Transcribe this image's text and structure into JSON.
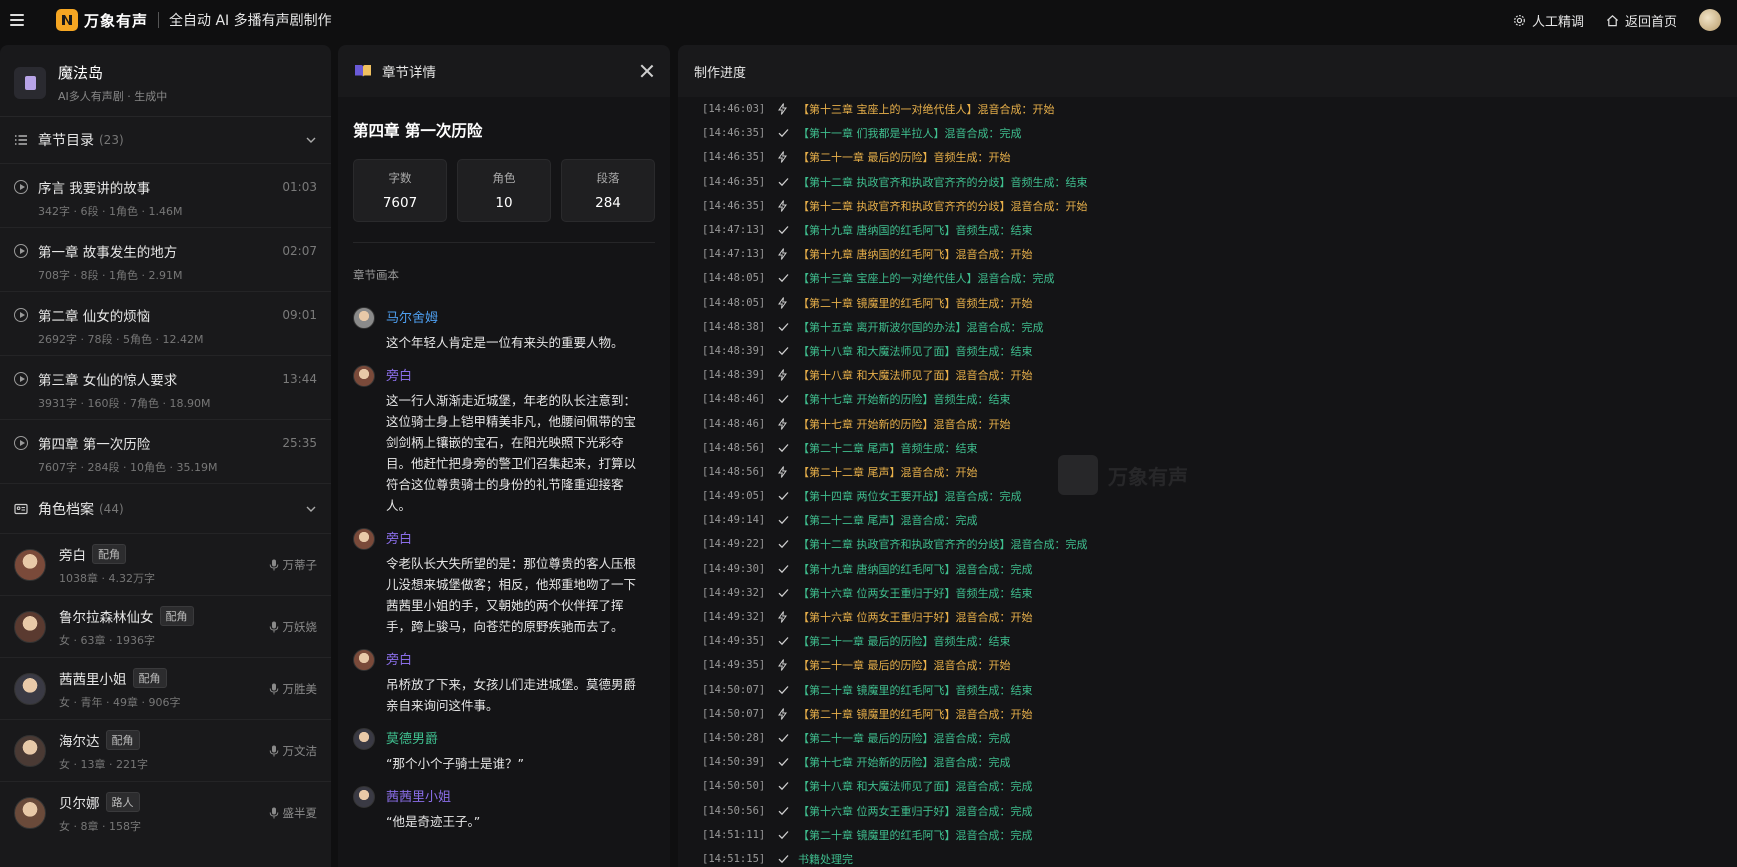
{
  "header": {
    "brand": "万象有声",
    "subtitle": "全自动 AI 多播有声剧制作",
    "manual_tune": "人工精调",
    "back_home": "返回首页"
  },
  "book": {
    "title": "魔法岛",
    "meta": "AI多人有声剧 · 生成中"
  },
  "chapters_section": {
    "title": "章节目录",
    "count": "(23)"
  },
  "chapters": [
    {
      "title": "序言 我要讲的故事",
      "meta": "342字 · 6段 · 1角色 · 1.46M",
      "time": "01:03"
    },
    {
      "title": "第一章 故事发生的地方",
      "meta": "708字 · 8段 · 1角色 · 2.91M",
      "time": "02:07"
    },
    {
      "title": "第二章 仙女的烦恼",
      "meta": "2692字 · 78段 · 5角色 · 12.42M",
      "time": "09:01"
    },
    {
      "title": "第三章 女仙的惊人要求",
      "meta": "3931字 · 160段 · 7角色 · 18.90M",
      "time": "13:44"
    },
    {
      "title": "第四章 第一次历险",
      "meta": "7607字 · 284段 · 10角色 · 35.19M",
      "time": "25:35"
    }
  ],
  "roles_section": {
    "title": "角色档案",
    "count": "(44)"
  },
  "roles": [
    {
      "name": "旁白",
      "tag": "配角",
      "meta": "1038章 · 4.32万字",
      "voice": "万蒂子",
      "color": "#7a4a3a"
    },
    {
      "name": "鲁尔拉森林仙女",
      "tag": "配角",
      "meta": "女 · 63章 · 1936字",
      "voice": "万妖娆",
      "color": "#5a3a30"
    },
    {
      "name": "茜茜里小姐",
      "tag": "配角",
      "meta": "女 · 青年 · 49章 · 906字",
      "voice": "万胜美",
      "color": "#3a3a44"
    },
    {
      "name": "海尔达",
      "tag": "配角",
      "meta": "女 · 13章 · 221字",
      "voice": "万文洁",
      "color": "#4a3a34"
    },
    {
      "name": "贝尔娜",
      "tag": "路人",
      "meta": "女 · 8章 · 158字",
      "voice": "盛半夏",
      "color": "#6a4a3a"
    }
  ],
  "detail": {
    "title": "章节详情",
    "chapter_name": "第四章 第一次历险",
    "stats": [
      {
        "label": "字数",
        "value": "7607"
      },
      {
        "label": "角色",
        "value": "10"
      },
      {
        "label": "段落",
        "value": "284"
      }
    ],
    "script_label": "章节画本",
    "lines": [
      {
        "speaker": "马尔舍姆",
        "color": "#4e9ff0",
        "text": "这个年轻人肯定是一位有来头的重要人物。",
        "avatar": "#8a8a8a"
      },
      {
        "speaker": "旁白",
        "color": "#8a6ee8",
        "text": "这一行人渐渐走近城堡，年老的队长注意到：这位骑士身上铠甲精美非凡，他腰间佩带的宝剑剑柄上镶嵌的宝石，在阳光映照下光彩夺目。他赶忙把身旁的警卫们召集起来，打算以符合这位尊贵骑士的身份的礼节隆重迎接客人。",
        "avatar": "#7a4a3a"
      },
      {
        "speaker": "旁白",
        "color": "#8a6ee8",
        "text": "令老队长大失所望的是：那位尊贵的客人压根儿没想来城堡做客；相反，他郑重地吻了一下茜茜里小姐的手，又朝她的两个伙伴挥了挥手，跨上骏马，向苍茫的原野疾驰而去了。",
        "avatar": "#7a4a3a"
      },
      {
        "speaker": "旁白",
        "color": "#8a6ee8",
        "text": "吊桥放了下来，女孩儿们走进城堡。莫德男爵亲自来询问这件事。",
        "avatar": "#7a4a3a"
      },
      {
        "speaker": "莫德男爵",
        "color": "#3fbf8f",
        "text": "“那个小个子骑士是谁？”",
        "avatar": "#3a3a44"
      },
      {
        "speaker": "茜茜里小姐",
        "color": "#8a6ee8",
        "text": "“他是奇迹王子。”",
        "avatar": "#3a3a44"
      }
    ]
  },
  "progress": {
    "title": "制作进度",
    "watermark": "万象有声",
    "logs": [
      {
        "time": "[14:46:03]",
        "status": "start",
        "text": "【第十三章 宝座上的一对绝代佳人】混音合成：开始"
      },
      {
        "time": "[14:46:35]",
        "status": "done",
        "text": "【第十一章 们我都是半拉人】混音合成：完成"
      },
      {
        "time": "[14:46:35]",
        "status": "start",
        "text": "【第二十一章 最后的历险】音频生成：开始"
      },
      {
        "time": "[14:46:35]",
        "status": "done",
        "text": "【第十二章 执政官齐和执政官齐齐的分歧】音频生成：结束"
      },
      {
        "time": "[14:46:35]",
        "status": "start",
        "text": "【第十二章 执政官齐和执政官齐齐的分歧】混音合成：开始"
      },
      {
        "time": "[14:47:13]",
        "status": "done",
        "text": "【第十九章 唐纳国的红毛阿飞】音频生成：结束"
      },
      {
        "time": "[14:47:13]",
        "status": "start",
        "text": "【第十九章 唐纳国的红毛阿飞】混音合成：开始"
      },
      {
        "time": "[14:48:05]",
        "status": "done",
        "text": "【第十三章 宝座上的一对绝代佳人】混音合成：完成"
      },
      {
        "time": "[14:48:05]",
        "status": "start",
        "text": "【第二十章 镜魔里的红毛阿飞】音频生成：开始"
      },
      {
        "time": "[14:48:38]",
        "status": "done",
        "text": "【第十五章 离开斯波尔国的办法】混音合成：完成"
      },
      {
        "time": "[14:48:39]",
        "status": "done",
        "text": "【第十八章 和大魔法师见了面】音频生成：结束"
      },
      {
        "time": "[14:48:39]",
        "status": "start",
        "text": "【第十八章 和大魔法师见了面】混音合成：开始"
      },
      {
        "time": "[14:48:46]",
        "status": "done",
        "text": "【第十七章 开始新的历险】音频生成：结束"
      },
      {
        "time": "[14:48:46]",
        "status": "start",
        "text": "【第十七章 开始新的历险】混音合成：开始"
      },
      {
        "time": "[14:48:56]",
        "status": "done",
        "text": "【第二十二章 尾声】音频生成：结束"
      },
      {
        "time": "[14:48:56]",
        "status": "start",
        "text": "【第二十二章 尾声】混音合成：开始"
      },
      {
        "time": "[14:49:05]",
        "status": "done",
        "text": "【第十四章 两位女王要开战】混音合成：完成"
      },
      {
        "time": "[14:49:14]",
        "status": "done",
        "text": "【第二十二章 尾声】混音合成：完成"
      },
      {
        "time": "[14:49:22]",
        "status": "done",
        "text": "【第十二章 执政官齐和执政官齐齐的分歧】混音合成：完成"
      },
      {
        "time": "[14:49:30]",
        "status": "done",
        "text": "【第十九章 唐纳国的红毛阿飞】混音合成：完成"
      },
      {
        "time": "[14:49:32]",
        "status": "done",
        "text": "【第十六章 位两女王重归于好】音频生成：结束"
      },
      {
        "time": "[14:49:32]",
        "status": "start",
        "text": "【第十六章 位两女王重归于好】混音合成：开始"
      },
      {
        "time": "[14:49:35]",
        "status": "done",
        "text": "【第二十一章 最后的历险】音频生成：结束"
      },
      {
        "time": "[14:49:35]",
        "status": "start",
        "text": "【第二十一章 最后的历险】混音合成：开始"
      },
      {
        "time": "[14:50:07]",
        "status": "done",
        "text": "【第二十章 镜魔里的红毛阿飞】音频生成：结束"
      },
      {
        "time": "[14:50:07]",
        "status": "start",
        "text": "【第二十章 镜魔里的红毛阿飞】混音合成：开始"
      },
      {
        "time": "[14:50:28]",
        "status": "done",
        "text": "【第二十一章 最后的历险】混音合成：完成"
      },
      {
        "time": "[14:50:39]",
        "status": "done",
        "text": "【第十七章 开始新的历险】混音合成：完成"
      },
      {
        "time": "[14:50:50]",
        "status": "done",
        "text": "【第十八章 和大魔法师见了面】混音合成：完成"
      },
      {
        "time": "[14:50:56]",
        "status": "done",
        "text": "【第十六章 位两女王重归于好】混音合成：完成"
      },
      {
        "time": "[14:51:11]",
        "status": "done",
        "text": "【第二十章 镜魔里的红毛阿飞】混音合成：完成"
      },
      {
        "time": "[14:51:15]",
        "status": "done",
        "text": "书籍处理完"
      }
    ]
  }
}
